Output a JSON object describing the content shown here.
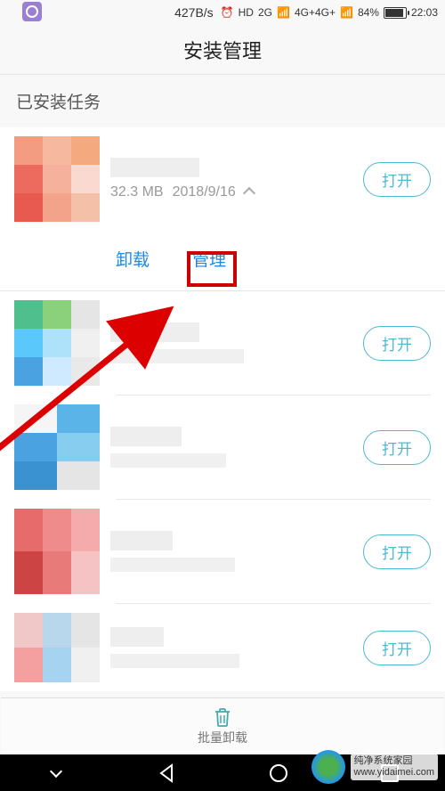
{
  "status_bar": {
    "net_speed": "427B/s",
    "signal_labels": [
      "2G",
      "4G+4G+"
    ],
    "battery_percent": "84%",
    "time": "22:03"
  },
  "header": {
    "title": "安装管理"
  },
  "section": {
    "installed_tasks": "已安装任务"
  },
  "apps": [
    {
      "size": "32.3 MB",
      "date": "2018/9/16",
      "open_label": "打开",
      "expanded": true
    },
    {
      "open_label": "打开"
    },
    {
      "open_label": "打开"
    },
    {
      "open_label": "打开"
    },
    {
      "open_label": "打开"
    }
  ],
  "actions": {
    "uninstall": "卸载",
    "manage": "管理"
  },
  "toolbar": {
    "batch_uninstall": "批量卸载"
  },
  "watermark": {
    "brand": "纯净系统家园",
    "url": "www.yidaimei.com"
  }
}
